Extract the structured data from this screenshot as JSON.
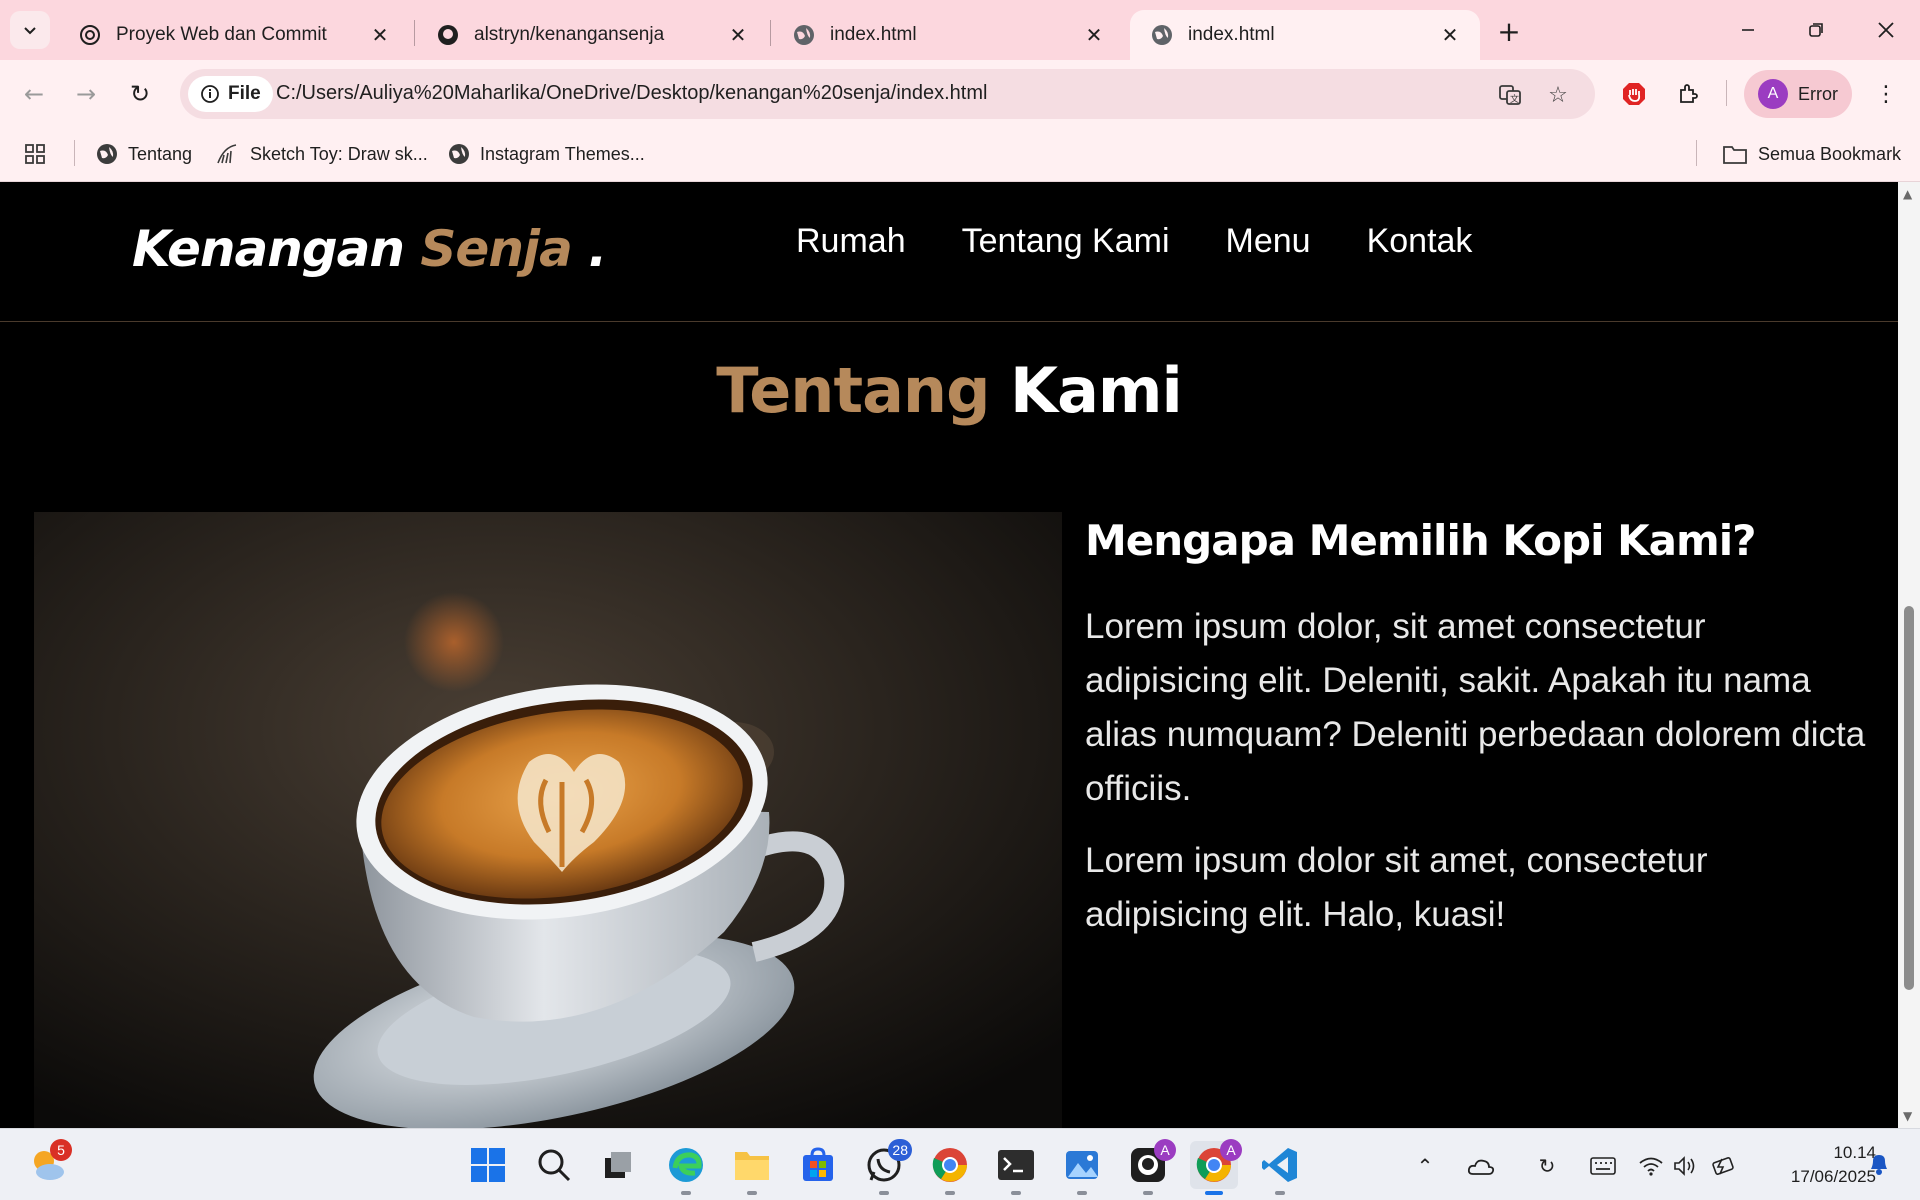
{
  "browser": {
    "tabs": [
      {
        "title": "Proyek Web dan Commit",
        "icon": "openai-icon"
      },
      {
        "title": "alstryn/kenangansenja",
        "icon": "github-icon"
      },
      {
        "title": "index.html",
        "icon": "globe-icon"
      },
      {
        "title": "index.html",
        "icon": "globe-icon",
        "active": true
      }
    ],
    "address": {
      "scheme_label": "File",
      "url": "C:/Users/Auliya%20Maharlika/OneDrive/Desktop/kenangan%20senja/index.html"
    },
    "profile": {
      "initial": "A",
      "status": "Error"
    },
    "bookmarks": [
      "Tentang",
      "Sketch Toy: Draw sk...",
      "Instagram Themes..."
    ],
    "all_bookmarks_label": "Semua Bookmark"
  },
  "site": {
    "logo": {
      "main": "Kenangan",
      "accent": "Senja",
      "suffix": "."
    },
    "nav": [
      "Rumah",
      "Tentang Kami",
      "Menu",
      "Kontak"
    ],
    "about": {
      "title_accent": "Tentang",
      "title_main": "Kami",
      "heading": "Mengapa Memilih Kopi Kami?",
      "paragraphs": [
        "Lorem ipsum dolor, sit amet consectetur adipisicing elit. Deleniti, sakit. Apakah itu nama alias numquam? Deleniti perbedaan dolorem dicta officiis.",
        "Lorem ipsum dolor sit amet, consectetur adipisicing elit. Halo, kuasi!"
      ]
    },
    "colors": {
      "accent": "#b6895b",
      "background": "#000000"
    }
  },
  "taskbar": {
    "weather_badge": "5",
    "whatsapp_badge": "28",
    "clock": {
      "time": "10.14",
      "date": "17/06/2025"
    }
  }
}
